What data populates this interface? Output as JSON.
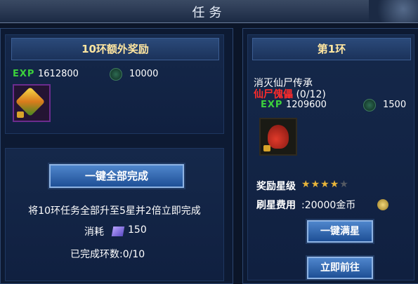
{
  "window": {
    "title": "任务"
  },
  "left": {
    "bonus_title": "10环额外奖励",
    "exp_label": "EXP",
    "exp_value": "1612800",
    "coin_value": "10000",
    "complete_all_button": "一键全部完成",
    "description": "将10环任务全部升至5星并2倍立即完成",
    "cost_label": "消耗",
    "cost_value": "150",
    "progress_text": "已完成环数:0/10"
  },
  "right": {
    "round_title": "第1环",
    "task_name": "消灭仙尸传承",
    "target_name": "仙尸傀儡",
    "target_progress": "(0/12)",
    "exp_label": "EXP",
    "exp_value": "1209600",
    "coin_value": "1500",
    "star_label": "奖励星级",
    "star_rating": 4,
    "star_max": 5,
    "refresh_cost_label": "刷星费用",
    "refresh_cost_value": ":20000金币",
    "max_star_button": "一键满星",
    "go_now_button": "立即前往"
  },
  "colors": {
    "exp_green": "#3cd13c",
    "target_red": "#ff2b2b",
    "gold": "#ffe6a0"
  }
}
